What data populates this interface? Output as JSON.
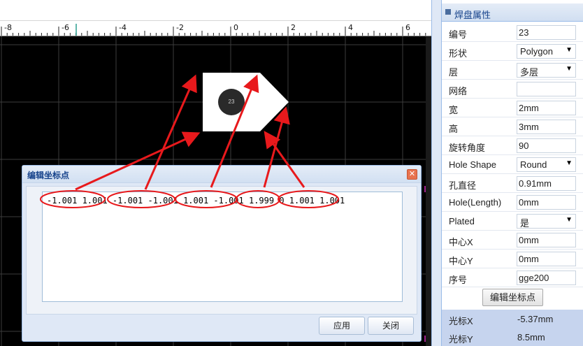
{
  "ruler": {
    "labels": [
      "-8",
      "-6",
      "-4",
      "-2",
      "0",
      "2",
      "4",
      "6"
    ]
  },
  "canvas": {
    "pad_number": "23",
    "colors": {
      "background": "#000000",
      "grid": "#3c3c3c",
      "pad": "#ffffff",
      "hole": "#2a2a2a",
      "marker": "#a0208e"
    }
  },
  "dialog": {
    "title": "编辑坐标点",
    "coordinates": "-1.001 1.001 -1.001 -1.001 1.001 -1.001 1.999 0 1.001 1.001",
    "apply_label": "应用",
    "close_label": "关闭",
    "close_icon": "close-icon"
  },
  "annotations": {
    "color": "#e8191c",
    "ellipse_count": 5,
    "arrow_count": 6
  },
  "panel": {
    "title": "焊盘属性",
    "rows": [
      {
        "label": "编号",
        "value": "23",
        "type": "text"
      },
      {
        "label": "形状",
        "value": "Polygon",
        "type": "select"
      },
      {
        "label": "层",
        "value": "多层",
        "type": "select"
      },
      {
        "label": "网络",
        "value": "",
        "type": "text"
      },
      {
        "label": "宽",
        "value": "2mm",
        "type": "text"
      },
      {
        "label": "高",
        "value": "3mm",
        "type": "text"
      },
      {
        "label": "旋转角度",
        "value": "90",
        "type": "text"
      },
      {
        "label": "Hole Shape",
        "value": "Round",
        "type": "select"
      },
      {
        "label": "孔直径",
        "value": "0.91mm",
        "type": "text"
      },
      {
        "label": "Hole(Length)",
        "value": "0mm",
        "type": "text"
      },
      {
        "label": "Plated",
        "value": "是",
        "type": "select"
      },
      {
        "label": "中心X",
        "value": "0mm",
        "type": "text"
      },
      {
        "label": "中心Y",
        "value": "0mm",
        "type": "text"
      },
      {
        "label": "序号",
        "value": "gge200",
        "type": "text"
      }
    ],
    "edit_button_label": "编辑坐标点",
    "cursor": [
      {
        "label": "光标X",
        "value": "-5.37mm"
      },
      {
        "label": "光标Y",
        "value": "8.5mm"
      }
    ]
  }
}
